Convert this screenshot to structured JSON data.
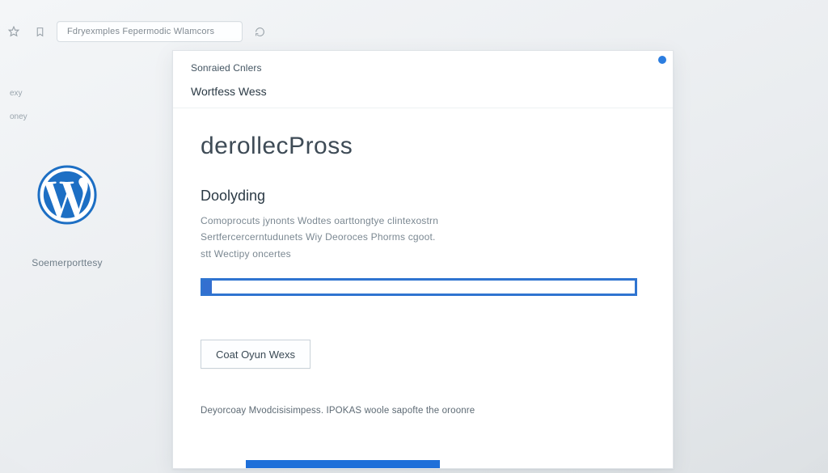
{
  "toolbar": {
    "url": "Fdryexmples Fepermodic Wlamcors",
    "icons": {
      "star": "star-icon",
      "bookmark": "bookmark-icon",
      "reload": "reload-icon"
    }
  },
  "sidebar": {
    "items": [
      {
        "label": "exy"
      },
      {
        "label": "oney"
      }
    ],
    "logo_alt": "WordPress logo",
    "selected_label": "Soemerporttesy"
  },
  "card": {
    "breadcrumb": "Sonraied Cnlers",
    "window_title": "Wortfess Wess",
    "app_title": "derollecPross",
    "section_heading": "Doolyding",
    "desc_line_1": "Comoprocuts jynonts Wodtes  oarttongtye clintexostrn",
    "desc_line_2": "Sertfercercerntudunets Wiy Deoroces Phorms cgoot.",
    "desc_line_3": "stt Wectipy oncertes",
    "progress_percent": 2,
    "button_label": "Coat Oyun Wexs",
    "footer_note": "Deyorcoay Mvodcisisimpess. IPOKAS  woole sapofte the oroonre",
    "bottom_strip_percent": 39
  },
  "colors": {
    "accent": "#2f74d0",
    "accent_deep": "#1e6fd9",
    "text_primary": "#2b3a45",
    "text_muted": "#7b8892"
  }
}
